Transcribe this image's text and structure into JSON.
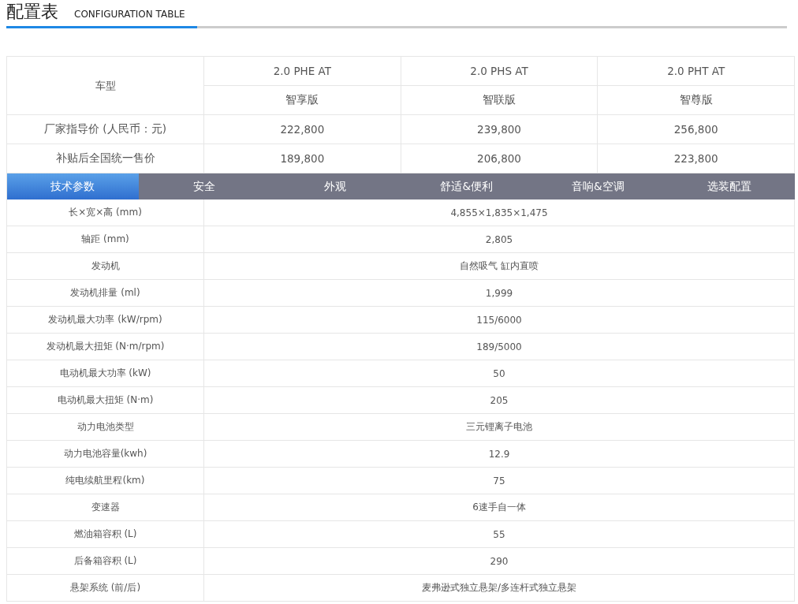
{
  "heading": {
    "title": "配置表",
    "subtitle": "CONFIGURATION TABLE"
  },
  "models": {
    "label": "车型",
    "columns": [
      {
        "name": "2.0 PHE AT",
        "edition": "智享版"
      },
      {
        "name": "2.0 PHS AT",
        "edition": "智联版"
      },
      {
        "name": "2.0 PHT AT",
        "edition": "智尊版"
      }
    ]
  },
  "prices": [
    {
      "label": "厂家指导价 (人民币：元)",
      "values": [
        "222,800",
        "239,800",
        "256,800"
      ]
    },
    {
      "label": "补贴后全国统一售价",
      "values": [
        "189,800",
        "206,800",
        "223,800"
      ]
    }
  ],
  "tabs": [
    {
      "label": "技术参数",
      "selected": true
    },
    {
      "label": "安全",
      "selected": false
    },
    {
      "label": "外观",
      "selected": false
    },
    {
      "label": "舒适&便利",
      "selected": false
    },
    {
      "label": "音响&空调",
      "selected": false
    },
    {
      "label": "选装配置",
      "selected": false
    }
  ],
  "specs": [
    {
      "label": "长×宽×高 (mm)",
      "value": "4,855×1,835×1,475"
    },
    {
      "label": "轴距 (mm)",
      "value": "2,805"
    },
    {
      "label": "发动机",
      "value": "自然吸气 缸内直喷"
    },
    {
      "label": "发动机排量 (ml)",
      "value": "1,999"
    },
    {
      "label": "发动机最大功率 (kW/rpm)",
      "value": "115/6000"
    },
    {
      "label": "发动机最大扭矩 (N·m/rpm)",
      "value": "189/5000"
    },
    {
      "label": "电动机最大功率 (kW)",
      "value": "50"
    },
    {
      "label": "电动机最大扭矩 (N·m)",
      "value": "205"
    },
    {
      "label": "动力电池类型",
      "value": "三元锂离子电池"
    },
    {
      "label": "动力电池容量(kwh)",
      "value": "12.9"
    },
    {
      "label": "纯电续航里程(km)",
      "value": "75"
    },
    {
      "label": "变速器",
      "value": "6速手自一体"
    },
    {
      "label": "燃油箱容积 (L)",
      "value": "55"
    },
    {
      "label": "后备箱容积 (L)",
      "value": "290"
    },
    {
      "label": "悬架系统 (前/后)",
      "value": "麦弗逊式独立悬架/多连杆式独立悬架"
    }
  ]
}
